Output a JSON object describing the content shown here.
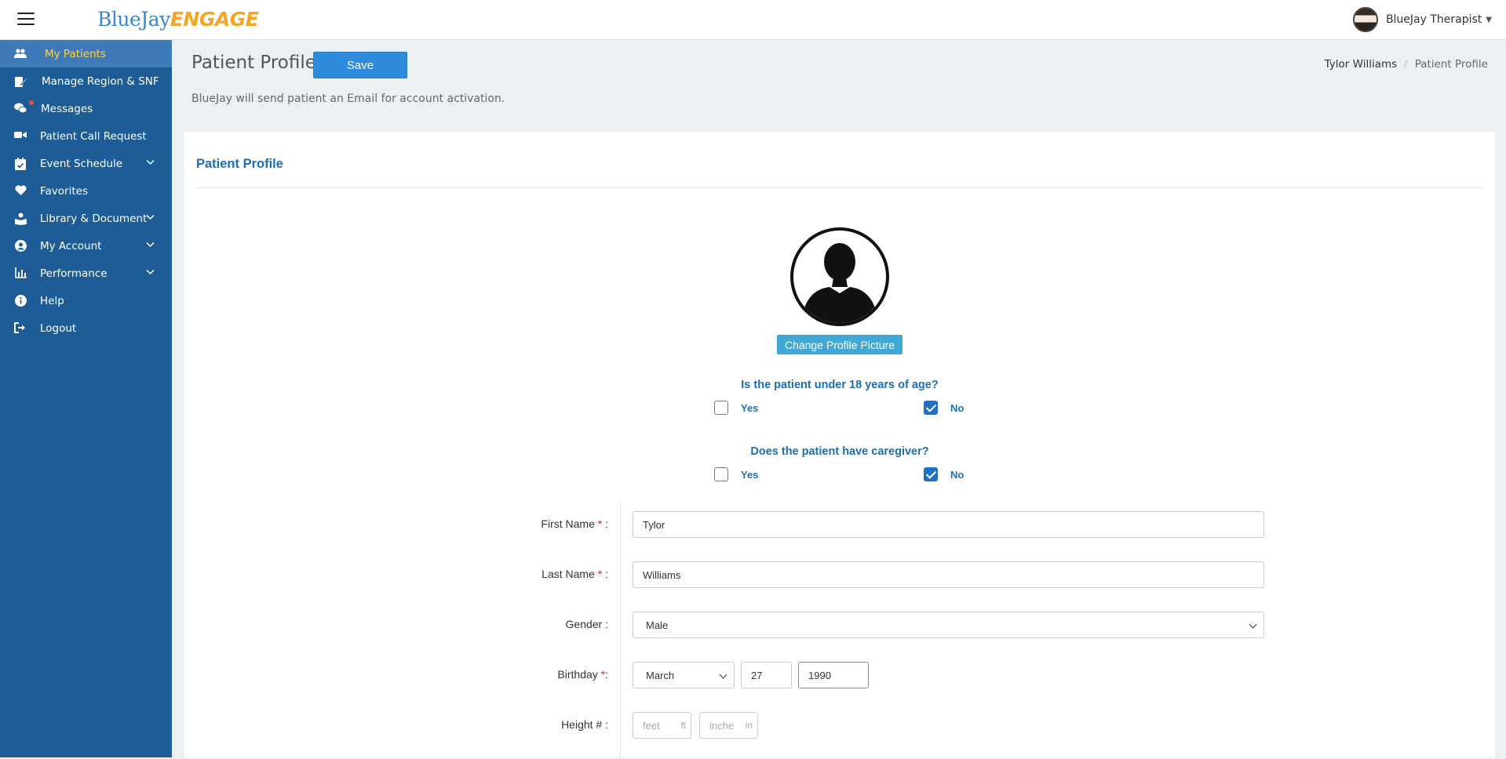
{
  "header": {
    "logo_prefix": "BlueJay",
    "logo_suffix": "ENGAGE",
    "user_name": "BlueJay Therapist"
  },
  "sidebar": {
    "items": [
      {
        "label": "My Patients",
        "icon": "users-icon",
        "active": true
      },
      {
        "label": "Manage Region & SNF",
        "icon": "edit-document-icon"
      },
      {
        "label": "Messages",
        "icon": "chat-icon",
        "badge": true
      },
      {
        "label": "Patient Call Request",
        "icon": "video-camera-icon"
      },
      {
        "label": "Event Schedule",
        "icon": "calendar-check-icon",
        "expandable": true
      },
      {
        "label": "Favorites",
        "icon": "heart-icon"
      },
      {
        "label": "Library & Document",
        "icon": "book-reader-icon",
        "expandable": true
      },
      {
        "label": "My Account",
        "icon": "user-circle-icon",
        "expandable": true
      },
      {
        "label": "Performance",
        "icon": "bar-chart-icon",
        "expandable": true
      },
      {
        "label": "Help",
        "icon": "info-icon"
      },
      {
        "label": "Logout",
        "icon": "logout-icon"
      }
    ]
  },
  "page": {
    "title": "Patient Profile",
    "save_label": "Save",
    "breadcrumb": [
      "Tylor Williams",
      "Patient Profile"
    ],
    "activation_note": "BlueJay will send patient an Email for account activation."
  },
  "card": {
    "title": "Patient Profile",
    "change_picture_label": "Change Profile Picture",
    "questions": [
      {
        "text": "Is the patient under 18 years of age?",
        "yes_label": "Yes",
        "no_label": "No",
        "selected": "No"
      },
      {
        "text": "Does the patient have caregiver?",
        "yes_label": "Yes",
        "no_label": "No",
        "selected": "No"
      }
    ]
  },
  "form": {
    "first_name": {
      "label": "First Name",
      "value": "Tylor"
    },
    "last_name": {
      "label": "Last Name",
      "value": "Williams"
    },
    "gender": {
      "label": "Gender :",
      "value": "Male"
    },
    "birthday": {
      "label": "Birthday",
      "month": "March",
      "day": "27",
      "year": "1990"
    },
    "height": {
      "label": "Height # :",
      "feet_placeholder": "feet",
      "feet_unit": "ft",
      "inches_placeholder": "inche",
      "inches_unit": "in"
    }
  },
  "colors": {
    "sidebar": "#1d5c96",
    "active_item": "#3e7ab7",
    "active_text": "#ffd24a",
    "accent_blue": "#2f8bdc",
    "logo_orange": "#f5a623"
  }
}
